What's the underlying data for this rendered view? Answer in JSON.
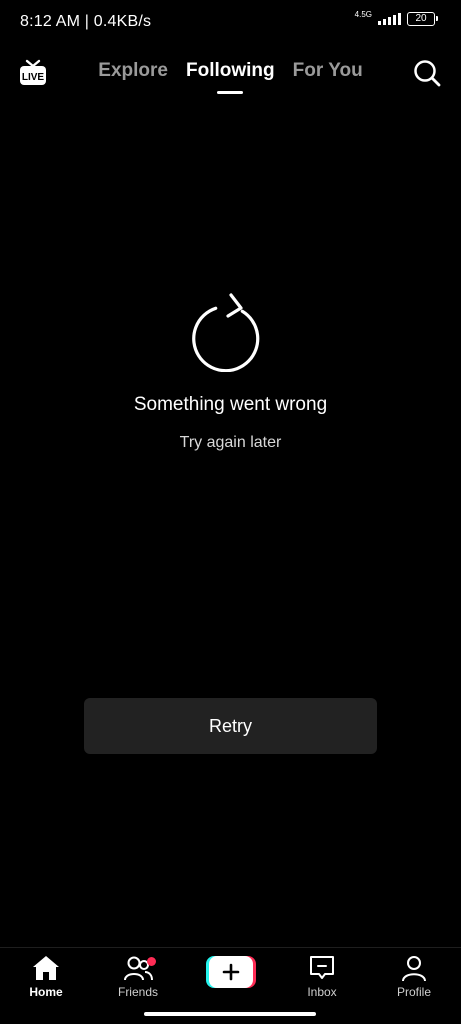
{
  "status_bar": {
    "time": "8:12 AM | 0.4KB/s",
    "network": "4.5G",
    "battery": "20"
  },
  "top_nav": {
    "live_label": "LIVE",
    "tabs": [
      {
        "label": "Explore",
        "active": false
      },
      {
        "label": "Following",
        "active": true
      },
      {
        "label": "For You",
        "active": false
      }
    ]
  },
  "error": {
    "title": "Something went wrong",
    "subtitle": "Try again later",
    "retry_label": "Retry"
  },
  "bottom_nav": {
    "items": [
      {
        "label": "Home",
        "icon": "home-icon",
        "active": true
      },
      {
        "label": "Friends",
        "icon": "friends-icon",
        "badge": true
      },
      {
        "label": "",
        "icon": "plus-icon"
      },
      {
        "label": "Inbox",
        "icon": "inbox-icon"
      },
      {
        "label": "Profile",
        "icon": "profile-icon"
      }
    ]
  },
  "colors": {
    "background": "#000000",
    "button_bg": "#222222",
    "accent_red": "#fe2c55",
    "accent_cyan": "#25f4ee",
    "inactive_tab": "#9a9a9a"
  }
}
